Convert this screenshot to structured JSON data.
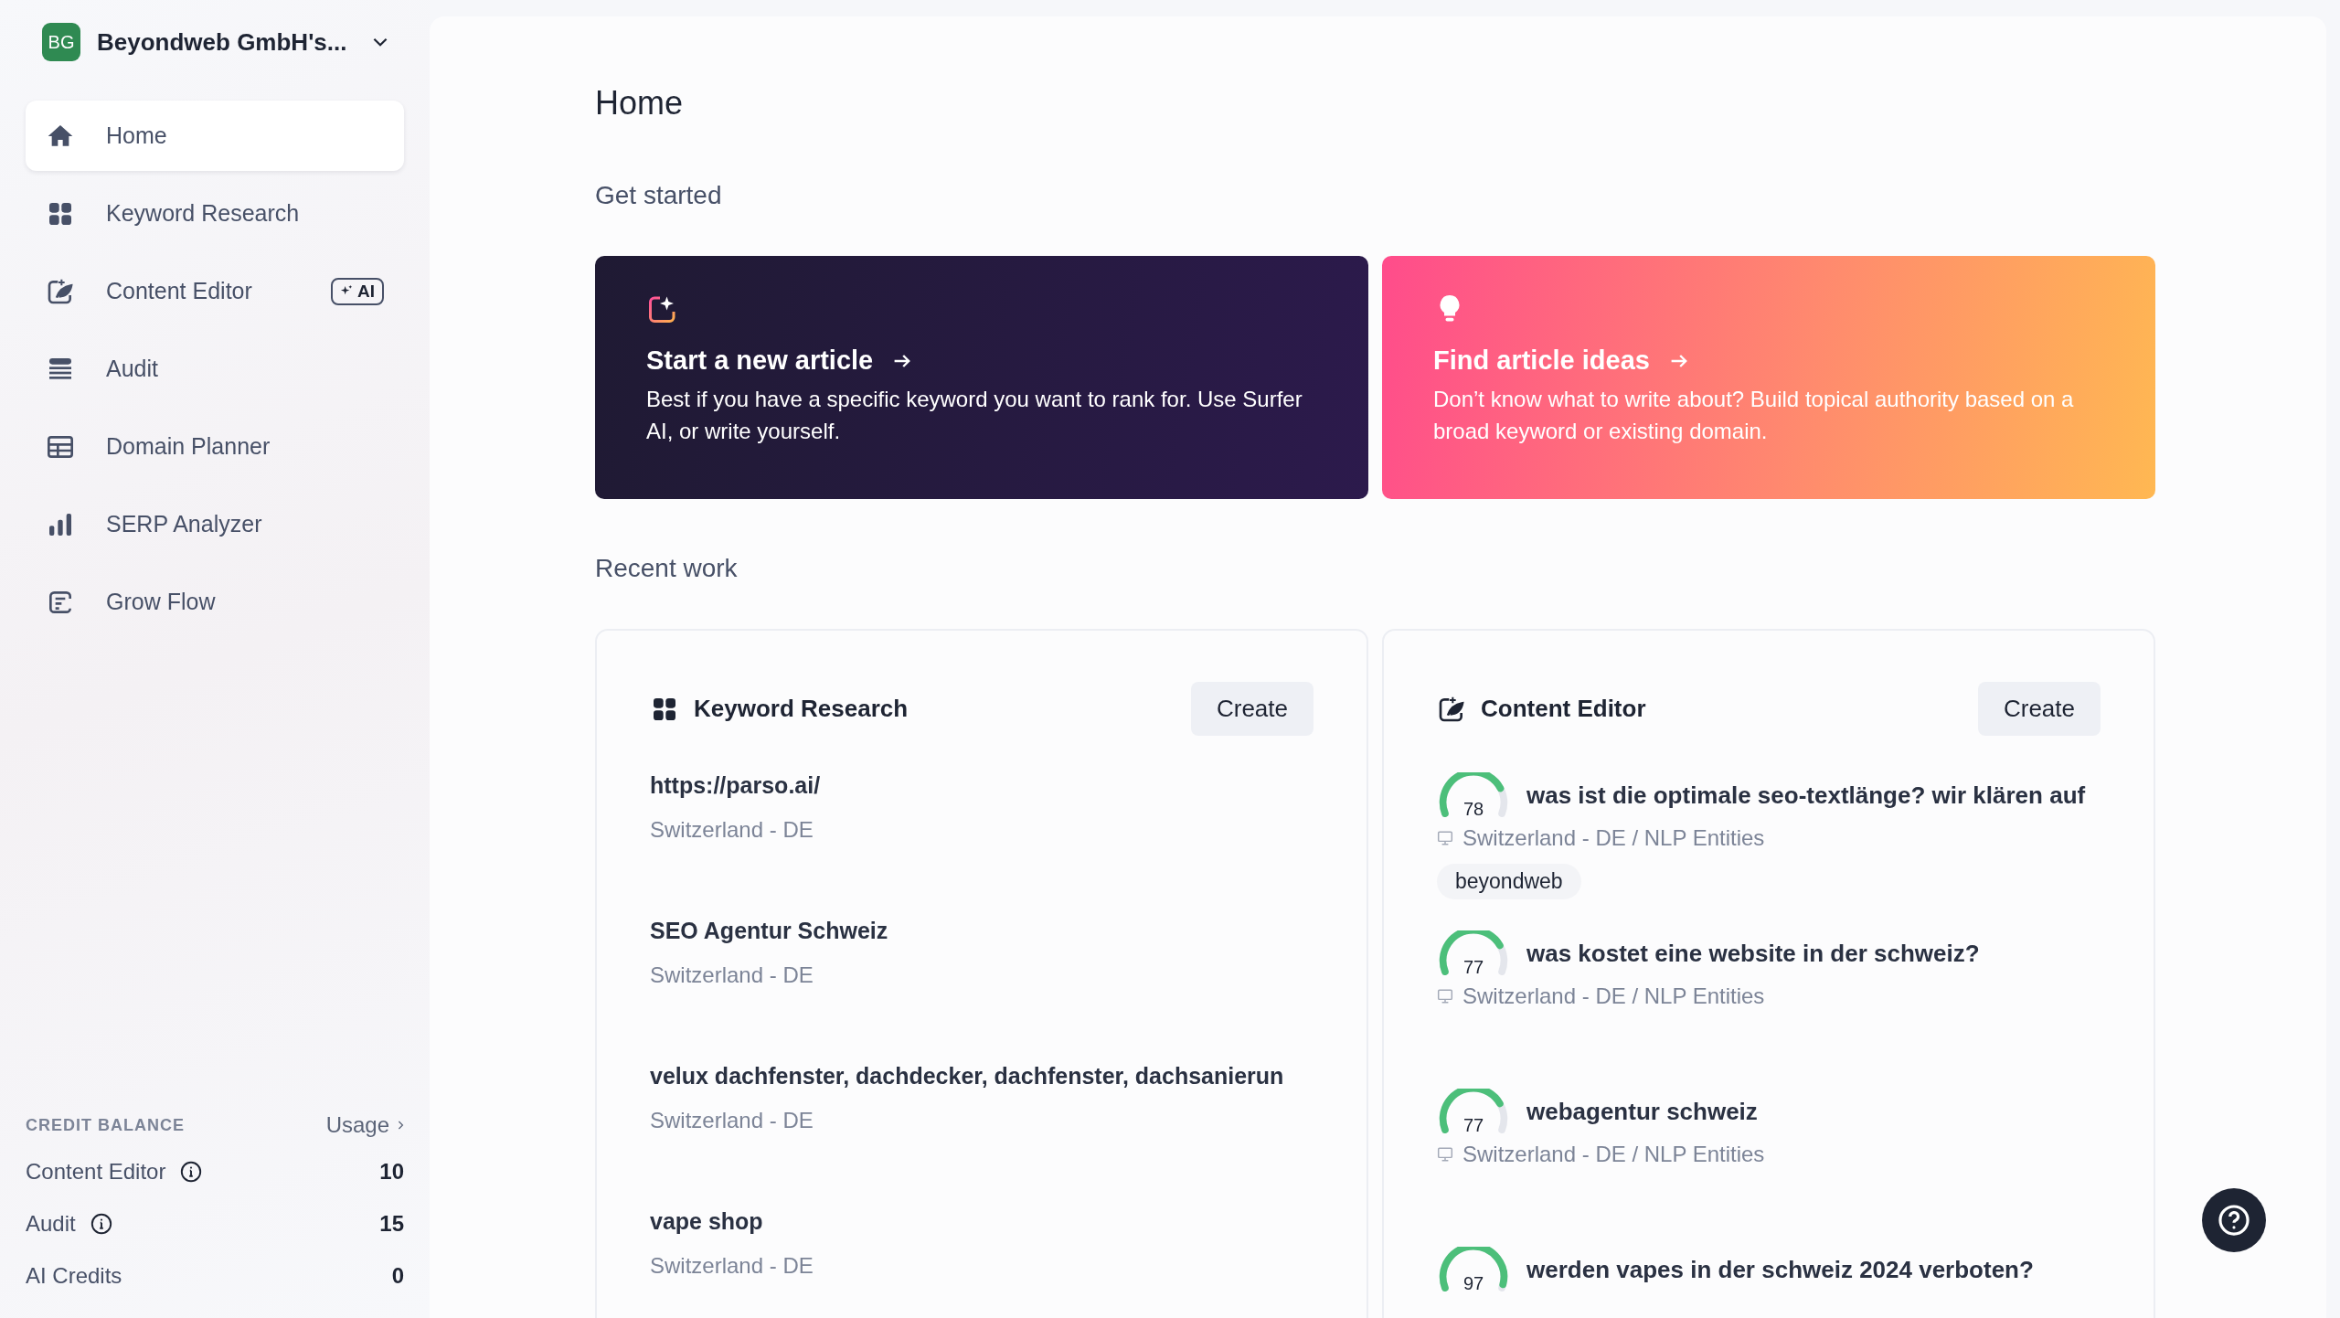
{
  "workspace": {
    "initials": "BG",
    "name": "Beyondweb GmbH's..."
  },
  "sidebar": {
    "items": [
      {
        "label": "Home",
        "selected": true
      },
      {
        "label": "Keyword Research",
        "selected": false
      },
      {
        "label": "Content Editor",
        "selected": false,
        "badge": "AI"
      },
      {
        "label": "Audit",
        "selected": false
      },
      {
        "label": "Domain Planner",
        "selected": false
      },
      {
        "label": "SERP Analyzer",
        "selected": false
      },
      {
        "label": "Grow Flow",
        "selected": false
      }
    ]
  },
  "credit_balance": {
    "title": "CREDIT BALANCE",
    "usage_link": "Usage",
    "rows": [
      {
        "label": "Content Editor",
        "info": true,
        "value": "10"
      },
      {
        "label": "Audit",
        "info": true,
        "value": "15"
      },
      {
        "label": "AI Credits",
        "info": false,
        "value": "0"
      }
    ]
  },
  "page": {
    "title": "Home",
    "get_started": {
      "heading": "Get started",
      "cards": [
        {
          "kind": "dark",
          "title": "Start a new article",
          "description": "Best if you have a specific keyword you want to rank for. Use Surfer AI, or write yourself."
        },
        {
          "kind": "warm",
          "title": "Find article ideas",
          "description": "Don’t know what to write about? Build topical authority based on a broad keyword or existing domain."
        }
      ]
    },
    "recent_work": {
      "heading": "Recent work",
      "panels": [
        {
          "kind": "keyword",
          "title": "Keyword Research",
          "button": "Create",
          "items": [
            {
              "title": "https://parso.ai/",
              "meta": "Switzerland - DE"
            },
            {
              "title": "SEO Agentur Schweiz",
              "meta": "Switzerland - DE"
            },
            {
              "title": "velux dachfenster, dachdecker, dachfenster, dachsanierun",
              "meta": "Switzerland - DE"
            },
            {
              "title": "vape shop",
              "meta": "Switzerland - DE"
            }
          ]
        },
        {
          "kind": "editor",
          "title": "Content Editor",
          "button": "Create",
          "items": [
            {
              "score": "78",
              "title": "was ist die optimale seo-textlänge? wir klären auf",
              "meta": "Switzerland - DE / NLP Entities",
              "tag": "beyondweb"
            },
            {
              "score": "77",
              "title": "was kostet eine website in der schweiz?",
              "meta": "Switzerland - DE / NLP Entities"
            },
            {
              "score": "77",
              "title": "webagentur schweiz",
              "meta": "Switzerland - DE / NLP Entities"
            },
            {
              "score": "97",
              "title": "werden vapes in der schweiz 2024 verboten?"
            }
          ]
        }
      ]
    }
  }
}
